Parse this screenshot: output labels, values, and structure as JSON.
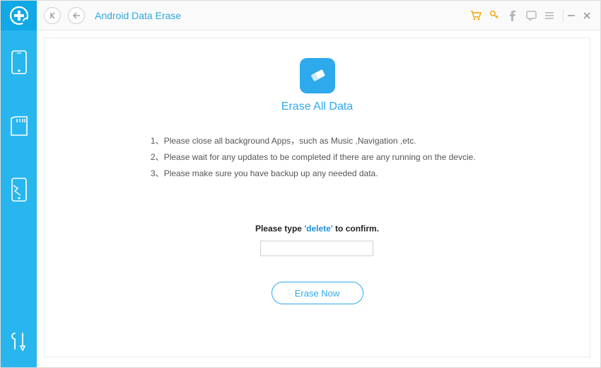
{
  "header": {
    "title": "Android Data Erase"
  },
  "main": {
    "heading": "Erase All Data",
    "instructions": [
      "Please close all background Apps，such as Music ,Navigation ,etc.",
      "Please wait for any updates to be completed if there are any running on the devcie.",
      "Please make sure you have backup up any needed data."
    ],
    "confirm": {
      "prefix": "Please type ",
      "keyword": "'delete'",
      "suffix": " to confirm.",
      "value": ""
    },
    "erase_button": "Erase Now"
  },
  "icons": {
    "logo": "plus-medical",
    "nav_home": "nav-home-icon",
    "nav_back": "nav-back-icon",
    "cart": "cart-icon",
    "key": "key-icon",
    "facebook": "facebook-icon",
    "feedback": "feedback-icon",
    "menu": "menu-icon",
    "minimize": "minimize-icon",
    "close": "close-icon",
    "rail_phone": "phone-icon",
    "rail_sd": "sd-card-icon",
    "rail_broken_phone": "broken-phone-icon",
    "rail_tools": "tools-icon",
    "eraser": "eraser-icon"
  },
  "colors": {
    "accent": "#2ea9ec",
    "rail": "#29b6ef",
    "rail_dark": "#11a8e6",
    "cart": "#f4a300"
  }
}
